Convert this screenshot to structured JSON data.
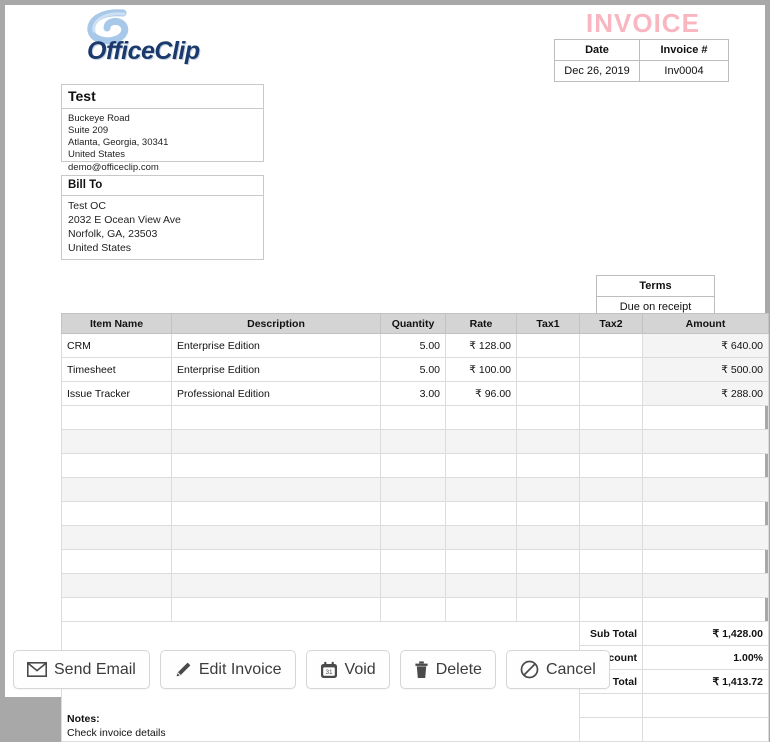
{
  "document": {
    "logo_text": "OfficeClip",
    "logo_icon": "swoosh-icon",
    "title": "INVOICE",
    "header_table": {
      "headers": [
        "Date",
        "Invoice #"
      ],
      "values": [
        "Dec 26, 2019",
        "Inv0004"
      ]
    },
    "company": {
      "name": "Test",
      "lines": [
        "Buckeye Road",
        "Suite 209",
        "Atlanta, Georgia, 30341",
        "United States",
        "demo@officeclip.com"
      ]
    },
    "bill_to": {
      "heading": "Bill To",
      "lines": [
        "Test OC",
        "2032 E Ocean View Ave",
        "Norfolk, GA, 23503",
        "United States"
      ]
    },
    "terms": {
      "header": "Terms",
      "value": "Due on receipt"
    },
    "items_table": {
      "headers": [
        "Item Name",
        "Description",
        "Quantity",
        "Rate",
        "Tax1",
        "Tax2",
        "Amount"
      ],
      "rows": [
        {
          "item": "CRM",
          "description": "Enterprise Edition",
          "quantity": "5.00",
          "rate": "₹ 128.00",
          "tax1": "",
          "tax2": "",
          "amount": "₹ 640.00"
        },
        {
          "item": "Timesheet",
          "description": "Enterprise Edition",
          "quantity": "5.00",
          "rate": "₹ 100.00",
          "tax1": "",
          "tax2": "",
          "amount": "₹ 500.00"
        },
        {
          "item": "Issue Tracker",
          "description": "Professional Edition",
          "quantity": "3.00",
          "rate": "₹ 96.00",
          "tax1": "",
          "tax2": "",
          "amount": "₹ 288.00"
        }
      ],
      "empty_row_count": 9
    },
    "totals": [
      {
        "label": "Sub Total",
        "value": "₹ 1,428.00"
      },
      {
        "label": "Discount",
        "value": "1.00%"
      },
      {
        "label": "Total",
        "value": "₹ 1,413.72"
      }
    ],
    "notes": {
      "title": "Notes:",
      "text": "Check invoice details"
    }
  },
  "actions": [
    {
      "label": "Send Email",
      "icon": "envelope-icon"
    },
    {
      "label": "Edit Invoice",
      "icon": "pencil-icon"
    },
    {
      "label": "Void",
      "icon": "calendar-icon"
    },
    {
      "label": "Delete",
      "icon": "trash-icon"
    },
    {
      "label": "Cancel",
      "icon": "no-entry-icon"
    }
  ],
  "colors": {
    "page_background": "#a8a8a8",
    "title_pink": "#f9b6c0",
    "logo_blue": "#1b3a6b",
    "table_header_gray": "#d4d4d4",
    "row_stripe": "#f4f4f4"
  }
}
